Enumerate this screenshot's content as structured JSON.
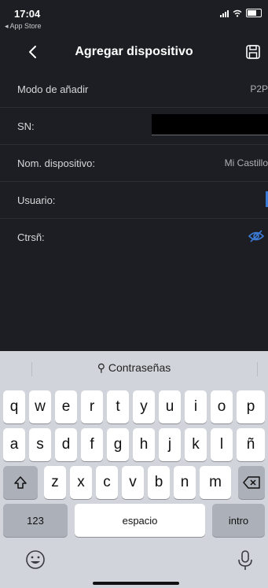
{
  "status_bar": {
    "time": "17:04",
    "back_app": "◂ App Store"
  },
  "nav": {
    "title": "Agregar dispositivo"
  },
  "form": {
    "rows": [
      {
        "label": "Modo de añadir",
        "value": "P2P"
      },
      {
        "label": "SN:",
        "value": ""
      },
      {
        "label": "Nom. dispositivo:",
        "value": "Mi Castillo"
      },
      {
        "label": "Usuario:",
        "value": ""
      },
      {
        "label": "Ctrsñ:",
        "value": ""
      }
    ]
  },
  "keyboard": {
    "suggestion": "Contraseñas",
    "row1": [
      "q",
      "w",
      "e",
      "r",
      "t",
      "y",
      "u",
      "i",
      "o",
      "p"
    ],
    "row2": [
      "a",
      "s",
      "d",
      "f",
      "g",
      "h",
      "j",
      "k",
      "l",
      "ñ"
    ],
    "row3": [
      "z",
      "x",
      "c",
      "v",
      "b",
      "n",
      "m"
    ],
    "numbers_key": "123",
    "space_key": "espacio",
    "return_key": "intro"
  },
  "colors": {
    "background": "#1d1e23",
    "accent": "#3b7bd6",
    "keyboard": "#d1d4da"
  }
}
